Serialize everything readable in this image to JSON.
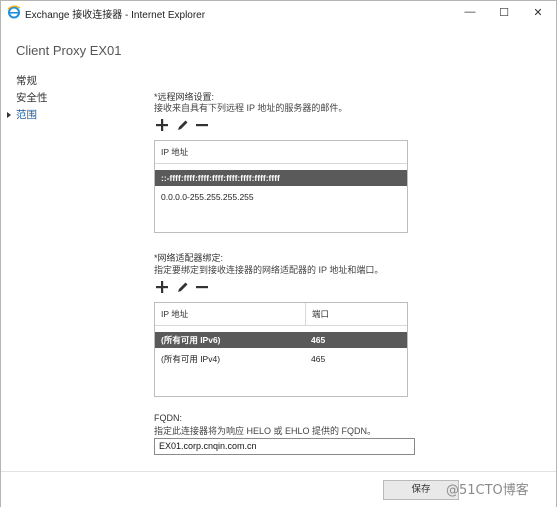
{
  "window": {
    "title": "Exchange 接收连接器 - Internet Explorer",
    "controls": {
      "minimize": "—",
      "maximize": "☐",
      "close": "✕"
    }
  },
  "page": {
    "title": "Client Proxy EX01"
  },
  "sidebar": {
    "items": [
      {
        "label": "常规",
        "active": false
      },
      {
        "label": "安全性",
        "active": false
      },
      {
        "label": "范围",
        "active": true
      }
    ]
  },
  "remote_network": {
    "label": "*远程网络设置:",
    "description": "接收来自具有下列远程 IP 地址的服务器的邮件。",
    "column_header": "IP 地址",
    "rows": [
      {
        "value": "::-ffff:ffff:ffff:ffff:ffff:ffff:ffff:ffff",
        "selected": true
      },
      {
        "value": "0.0.0.0-255.255.255.255",
        "selected": false
      }
    ]
  },
  "network_adapter": {
    "label": "*网络适配器绑定:",
    "description": "指定要绑定到接收连接器的网络适配器的 IP 地址和端口。",
    "columns": [
      "IP 地址",
      "端口"
    ],
    "rows": [
      {
        "ip": "(所有可用 IPv6)",
        "port": "465",
        "selected": true
      },
      {
        "ip": "(所有可用 IPv4)",
        "port": "465",
        "selected": false
      }
    ]
  },
  "fqdn": {
    "label": "FQDN:",
    "description": "指定此连接器将为响应 HELO 或 EHLO 提供的 FQDN。",
    "value": "EX01.corp.cnqin.com.cn"
  },
  "footer": {
    "save_label": "保存"
  },
  "watermark": {
    "text": "@51CTO博客"
  },
  "icons": {
    "add": "plus-icon",
    "edit": "pencil-icon",
    "remove": "minus-icon",
    "ie": "internet-explorer-icon"
  },
  "colors": {
    "accent": "#1b5c9c",
    "selected_row": "#5a5a5a"
  }
}
